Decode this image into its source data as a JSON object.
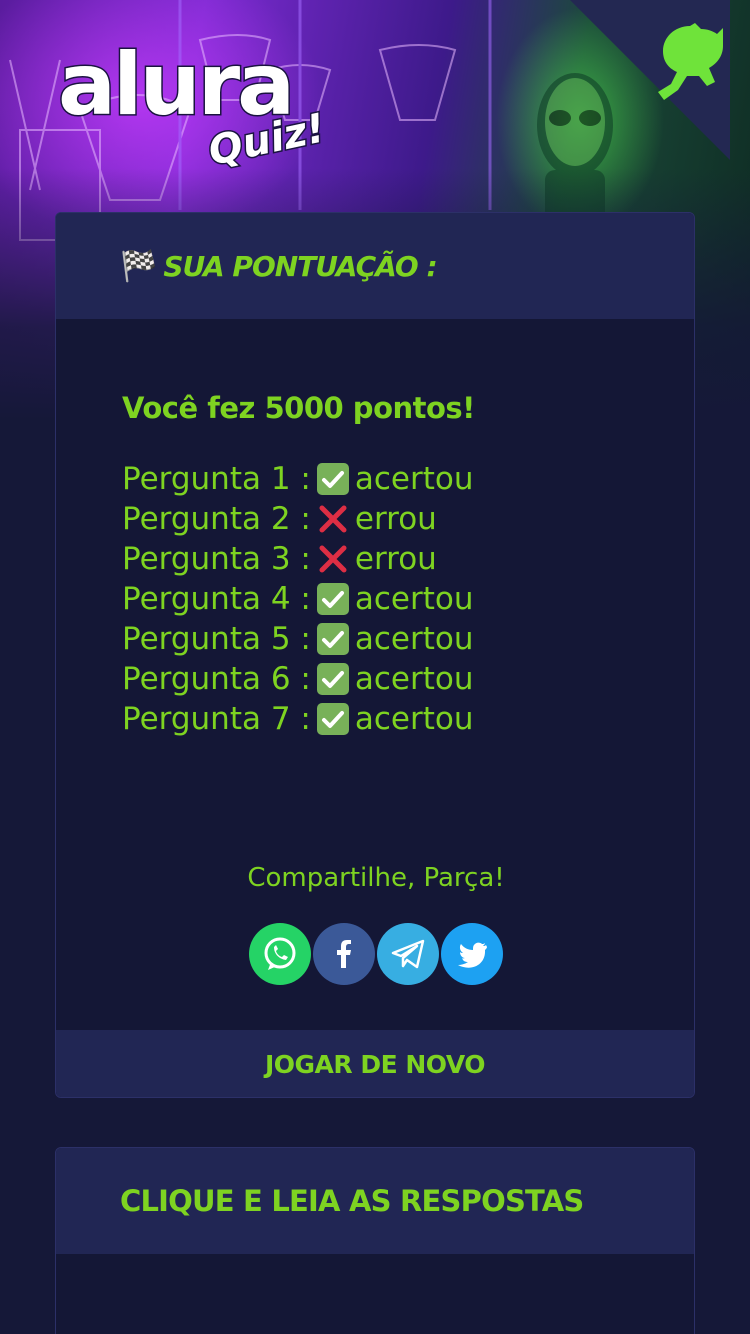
{
  "brand": {
    "logo_main": "alura",
    "logo_sub": "Quiz!",
    "accent": "#7ed321",
    "card_bg": "#141736",
    "card_head_bg": "#212654"
  },
  "corner": {
    "icon": "github-octocat-icon"
  },
  "result": {
    "flag_icon": "🏁",
    "title": "SUA PONTUAÇÃO :",
    "score_text": "Você fez 5000 pontos!",
    "answers": [
      {
        "label": "Pergunta 1 :",
        "mark": "✅",
        "status": "acertou",
        "correct": true
      },
      {
        "label": "Pergunta 2 :",
        "mark": "❌",
        "status": "errou",
        "correct": false
      },
      {
        "label": "Pergunta 3 :",
        "mark": "❌",
        "status": "errou",
        "correct": false
      },
      {
        "label": "Pergunta 4 :",
        "mark": "✅",
        "status": "acertou",
        "correct": true
      },
      {
        "label": "Pergunta 5 :",
        "mark": "✅",
        "status": "acertou",
        "correct": true
      },
      {
        "label": "Pergunta 6 :",
        "mark": "✅",
        "status": "acertou",
        "correct": true
      },
      {
        "label": "Pergunta 7 :",
        "mark": "✅",
        "status": "acertou",
        "correct": true
      }
    ],
    "share_label": "Compartilhe, Parça!",
    "share_buttons": [
      {
        "name": "whatsapp",
        "icon": "whatsapp-icon",
        "color": "#25d366"
      },
      {
        "name": "facebook",
        "icon": "facebook-icon",
        "color": "#3b5998"
      },
      {
        "name": "telegram",
        "icon": "telegram-icon",
        "color": "#37aee2"
      },
      {
        "name": "twitter",
        "icon": "twitter-icon",
        "color": "#1da1f2"
      }
    ],
    "play_again_label": "JOGAR DE NOVO"
  },
  "answers_section": {
    "title": "CLIQUE E LEIA AS RESPOSTAS"
  }
}
